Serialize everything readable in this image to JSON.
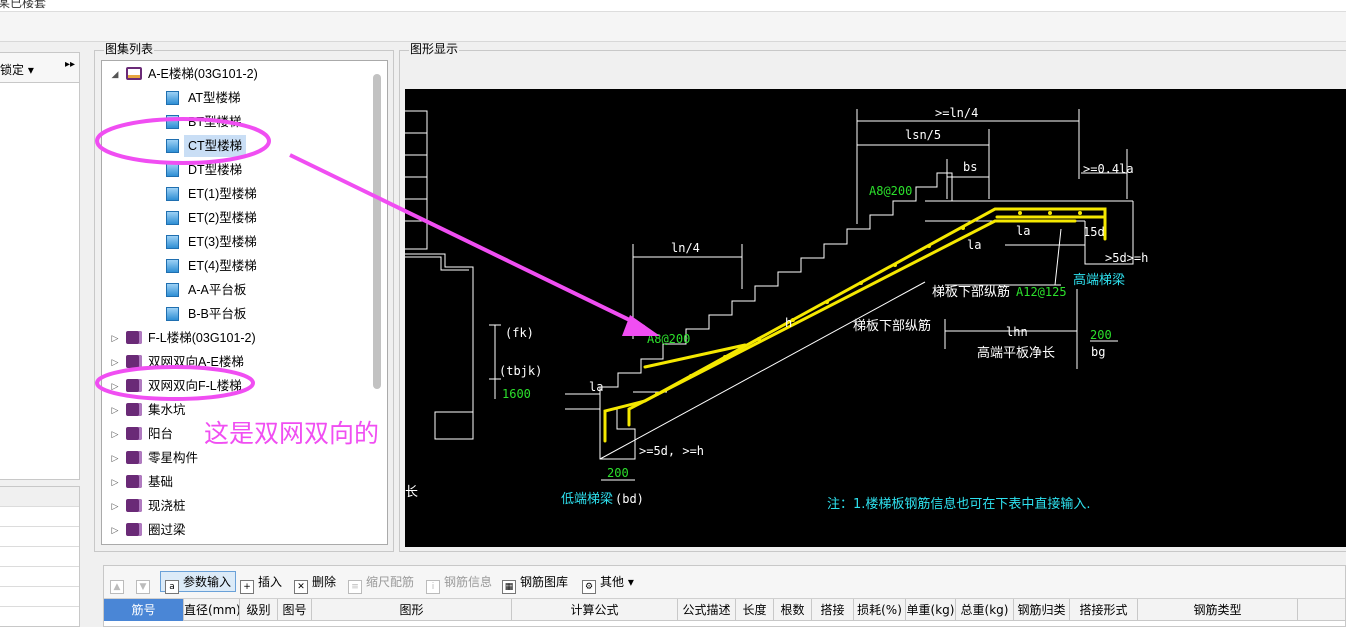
{
  "window": {
    "title_fragment": "某已楼套"
  },
  "left_panel": {
    "lock_label": "锁定",
    "arrows": "▸▸"
  },
  "atlas": {
    "title": "图集列表",
    "items": [
      {
        "label": "A-E楼梯(03G101-2)",
        "kind": "book-open",
        "expander": "◢",
        "level": 0
      },
      {
        "label": "AT型楼梯",
        "kind": "sheet",
        "level": 1
      },
      {
        "label": "BT型楼梯",
        "kind": "sheet",
        "level": 1
      },
      {
        "label": "CT型楼梯",
        "kind": "sheet",
        "level": 1,
        "selected": true
      },
      {
        "label": "DT型楼梯",
        "kind": "sheet",
        "level": 1
      },
      {
        "label": "ET(1)型楼梯",
        "kind": "sheet",
        "level": 1
      },
      {
        "label": "ET(2)型楼梯",
        "kind": "sheet",
        "level": 1
      },
      {
        "label": "ET(3)型楼梯",
        "kind": "sheet",
        "level": 1
      },
      {
        "label": "ET(4)型楼梯",
        "kind": "sheet",
        "level": 1
      },
      {
        "label": "A-A平台板",
        "kind": "sheet",
        "level": 1
      },
      {
        "label": "B-B平台板",
        "kind": "sheet",
        "level": 1
      },
      {
        "label": "F-L楼梯(03G101-2)",
        "kind": "book",
        "expander": "▷",
        "level": 0
      },
      {
        "label": "双网双向A-E楼梯",
        "kind": "book",
        "expander": "▷",
        "level": 0
      },
      {
        "label": "双网双向F-L楼梯",
        "kind": "book",
        "expander": "▷",
        "level": 0
      },
      {
        "label": "集水坑",
        "kind": "book",
        "expander": "▷",
        "level": 0
      },
      {
        "label": "阳台",
        "kind": "book",
        "expander": "▷",
        "level": 0
      },
      {
        "label": "零星构件",
        "kind": "book",
        "expander": "▷",
        "level": 0
      },
      {
        "label": "基础",
        "kind": "book",
        "expander": "▷",
        "level": 0
      },
      {
        "label": "现浇桩",
        "kind": "book",
        "expander": "▷",
        "level": 0
      },
      {
        "label": "圈过梁",
        "kind": "book",
        "expander": "▷",
        "level": 0
      }
    ]
  },
  "display": {
    "title": "图形显示",
    "labels": {
      "ln4_top": ">=ln/4",
      "lsn5": "lsn/5",
      "bs": "bs",
      "la041": ">=0.4la",
      "a8_200": "A8@200",
      "d15": "15d",
      "d5_right": ">5d>=h",
      "high_beam": "高端梯梁",
      "la_a": "la",
      "la_b": "la",
      "bottom_bar": "梯板下部纵筋",
      "a12_125": "A12@125",
      "ln4_mid": "ln/4",
      "fk": "(fk)",
      "h": "h",
      "bottom_bar2": "梯板下部纵筋",
      "lhn": "lhn",
      "b200_right": "200",
      "high_flat": "高端平板净长",
      "bg": "bg",
      "a8_200_b": "A8@200",
      "tbjk": "(tbjk)",
      "v1600": "1600",
      "la_left": "la",
      "d5_left": ">=5d, >=h",
      "b200_left": "200",
      "low_beam": "低端梯梁",
      "bd": "(bd)",
      "note": "注：1.楼梯板钢筋信息也可在下表中直接输入.",
      "long_frag": "长"
    }
  },
  "annotation": {
    "text": "这是双网双向的",
    "color": "#f04ef2"
  },
  "toolbar": {
    "items": [
      {
        "label": "",
        "icon": "▲",
        "state": "dim"
      },
      {
        "label": "",
        "icon": "▼",
        "state": "dim"
      },
      {
        "label": "参数输入",
        "icon": "a",
        "state": "active"
      },
      {
        "label": "插入",
        "icon": "+",
        "state": "normal"
      },
      {
        "label": "删除",
        "icon": "✕",
        "state": "normal"
      },
      {
        "label": "缩尺配筋",
        "icon": "≡",
        "state": "dim"
      },
      {
        "label": "钢筋信息",
        "icon": "i",
        "state": "dim"
      },
      {
        "label": "钢筋图库",
        "icon": "▦",
        "state": "normal"
      },
      {
        "label": "其他 ▾",
        "icon": "⚙",
        "state": "normal"
      }
    ]
  },
  "grid": {
    "columns": [
      "筋号",
      "直径(mm)",
      "级别",
      "图号",
      "图形",
      "计算公式",
      "公式描述",
      "长度",
      "根数",
      "搭接",
      "损耗(%)",
      "单重(kg)",
      "总重(kg)",
      "钢筋归类",
      "搭接形式",
      "钢筋类型"
    ]
  }
}
